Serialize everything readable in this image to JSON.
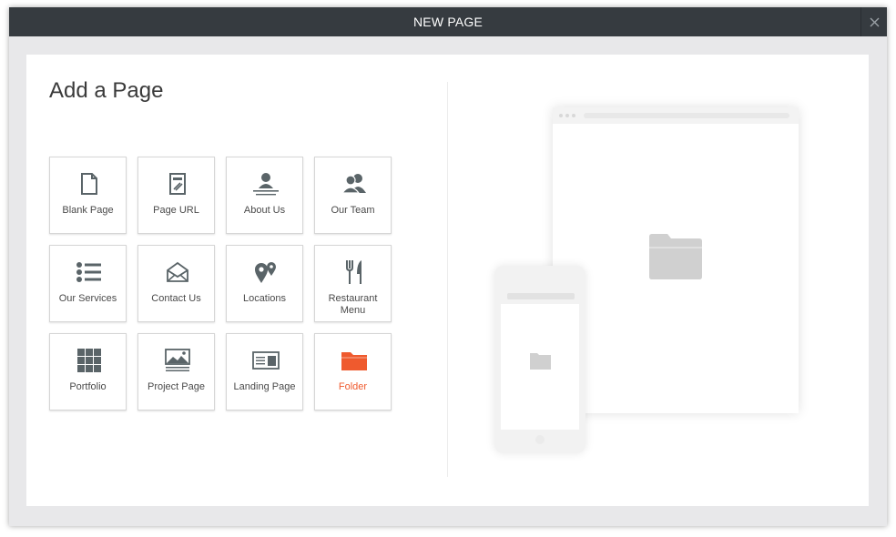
{
  "window": {
    "title": "NEW PAGE",
    "close_icon": "close-icon"
  },
  "main": {
    "heading": "Add a Page"
  },
  "tiles": [
    {
      "label": "Blank Page",
      "icon": "blank-page-icon"
    },
    {
      "label": "Page URL",
      "icon": "page-url-icon"
    },
    {
      "label": "About Us",
      "icon": "about-us-icon"
    },
    {
      "label": "Our Team",
      "icon": "our-team-icon"
    },
    {
      "label": "Our Services",
      "icon": "list-icon"
    },
    {
      "label": "Contact Us",
      "icon": "envelope-icon"
    },
    {
      "label": "Locations",
      "icon": "map-pins-icon"
    },
    {
      "label": "Restaurant Menu",
      "icon": "fork-knife-icon"
    },
    {
      "label": "Portfolio",
      "icon": "grid-icon"
    },
    {
      "label": "Project Page",
      "icon": "image-page-icon"
    },
    {
      "label": "Landing Page",
      "icon": "landing-page-icon"
    },
    {
      "label": "Folder",
      "icon": "folder-icon"
    }
  ],
  "colors": {
    "titlebar": "#363b40",
    "icon": "#5a6468",
    "accent": "#ef5a2e",
    "preview_folder": "#d0d0d0"
  },
  "preview": {
    "desktop_icon": "folder-icon",
    "mobile_icon": "folder-icon"
  }
}
